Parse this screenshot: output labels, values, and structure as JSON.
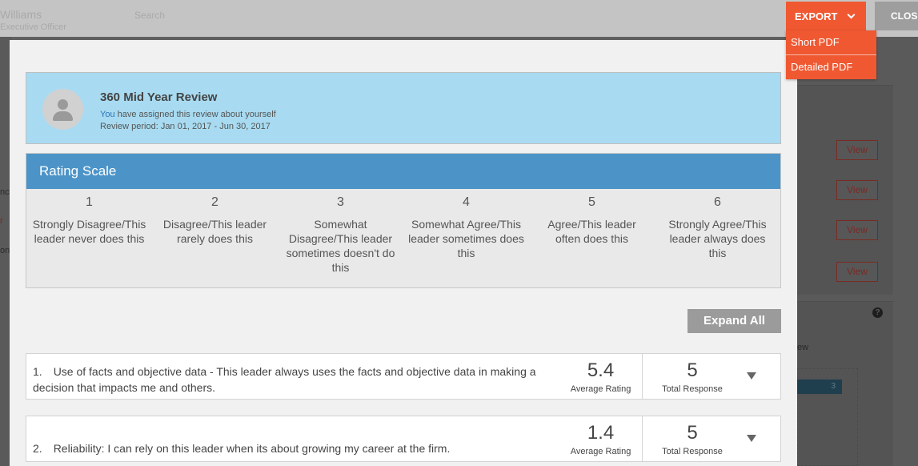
{
  "background": {
    "user_name": "Williams",
    "user_title": "Executive Officer",
    "search": "Search",
    "left_fragments": [
      "nc",
      "r",
      "on"
    ],
    "view_buttons": [
      "View",
      "View",
      "View",
      "View"
    ],
    "help": "?",
    "chart_fragment": "ew",
    "bar_value": "3"
  },
  "header": {
    "export_label": "EXPORT",
    "close_label": "CLOS",
    "export_menu": [
      "Short PDF",
      "Detailed PDF"
    ]
  },
  "review": {
    "title": "360 Mid Year Review",
    "you": "You",
    "assigned_text": " have assigned this review about yourself",
    "period": "Review period: Jan 01, 2017 - Jun 30, 2017"
  },
  "rating_scale": {
    "title": "Rating Scale",
    "levels": [
      {
        "num": "1",
        "label": "Strongly Disagree/This leader never does this"
      },
      {
        "num": "2",
        "label": "Disagree/This leader rarely does this"
      },
      {
        "num": "3",
        "label": "Somewhat Disagree/This leader sometimes doesn't do this"
      },
      {
        "num": "4",
        "label": "Somewhat Agree/This leader sometimes does this"
      },
      {
        "num": "5",
        "label": "Agree/This leader often does this"
      },
      {
        "num": "6",
        "label": "Strongly Agree/This leader always does this"
      }
    ]
  },
  "expand_all_label": "Expand All",
  "questions": [
    {
      "number": "1.",
      "text": "Use of facts and objective data - This leader always uses the facts and objective data in making a decision that impacts me and others.",
      "avg": "5.4",
      "avg_label": "Average Rating",
      "total": "5",
      "total_label": "Total Response"
    },
    {
      "number": "2.",
      "text": "Reliability: I can rely on this leader when its about growing my career at the firm.",
      "avg": "1.4",
      "avg_label": "Average Rating",
      "total": "5",
      "total_label": "Total Response"
    }
  ]
}
